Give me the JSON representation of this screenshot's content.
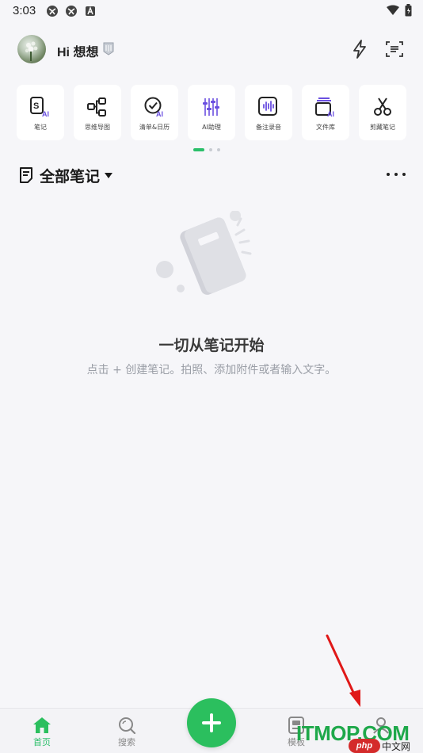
{
  "status_bar": {
    "time": "3:03"
  },
  "header": {
    "greeting": "Hi 想想",
    "flash_icon": "lightning-icon",
    "scan_icon": "scan-icon"
  },
  "tools": [
    {
      "label": "笔记",
      "icon": "ai-note-icon"
    },
    {
      "label": "思维导图",
      "icon": "mindmap-icon"
    },
    {
      "label": "清单&日历",
      "icon": "checklist-ai-icon"
    },
    {
      "label": "AI助理",
      "icon": "equalizer-icon"
    },
    {
      "label": "备注录音",
      "icon": "voice-record-icon"
    },
    {
      "label": "文件库",
      "icon": "file-library-ai-icon"
    },
    {
      "label": "剪藏笔记",
      "icon": "scissors-icon"
    }
  ],
  "pager": {
    "pages": 3,
    "active": 0
  },
  "section": {
    "title": "全部笔记"
  },
  "empty_state": {
    "title": "一切从笔记开始",
    "subtitle": "点击 + 创建笔记。拍照、添加附件或者输入文字。"
  },
  "bottom_nav": {
    "items": [
      {
        "label": "首页",
        "icon": "home-icon",
        "active": true
      },
      {
        "label": "搜索",
        "icon": "search-icon",
        "active": false
      },
      {
        "label": "模板",
        "icon": "template-icon",
        "active": false
      },
      {
        "label": "",
        "icon": "profile-icon",
        "active": false
      }
    ],
    "fab_icon": "plus-icon"
  },
  "watermark": {
    "text": "ITMOP.COM",
    "php": "php",
    "cn": "中文网"
  },
  "colors": {
    "accent": "#2bbf5e",
    "ai_purple": "#6a4fe0",
    "background": "#f6f6f9"
  }
}
